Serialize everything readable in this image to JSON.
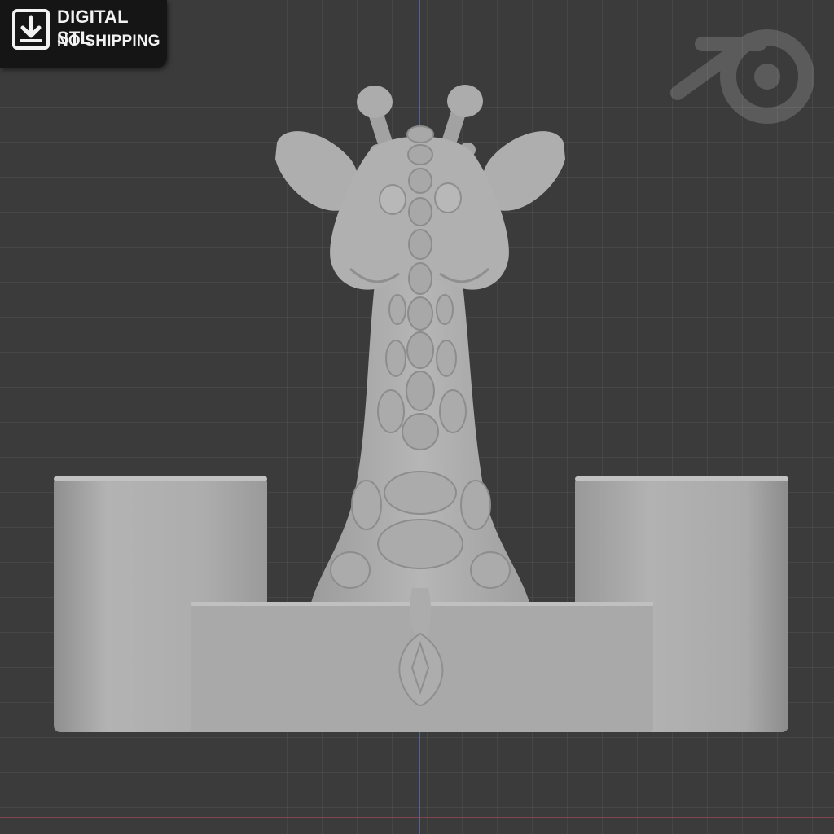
{
  "badge": {
    "line1": "DIGITAL STL",
    "line2": "NO SHIPPING",
    "icon": "download-icon"
  },
  "watermark": {
    "icon": "blender-logo-icon"
  },
  "viewport": {
    "background": "#3b3b3b",
    "model_color": "#a9a9a9",
    "axis_x_color": "#9b4a55",
    "axis_y_color": "#5470a6"
  }
}
